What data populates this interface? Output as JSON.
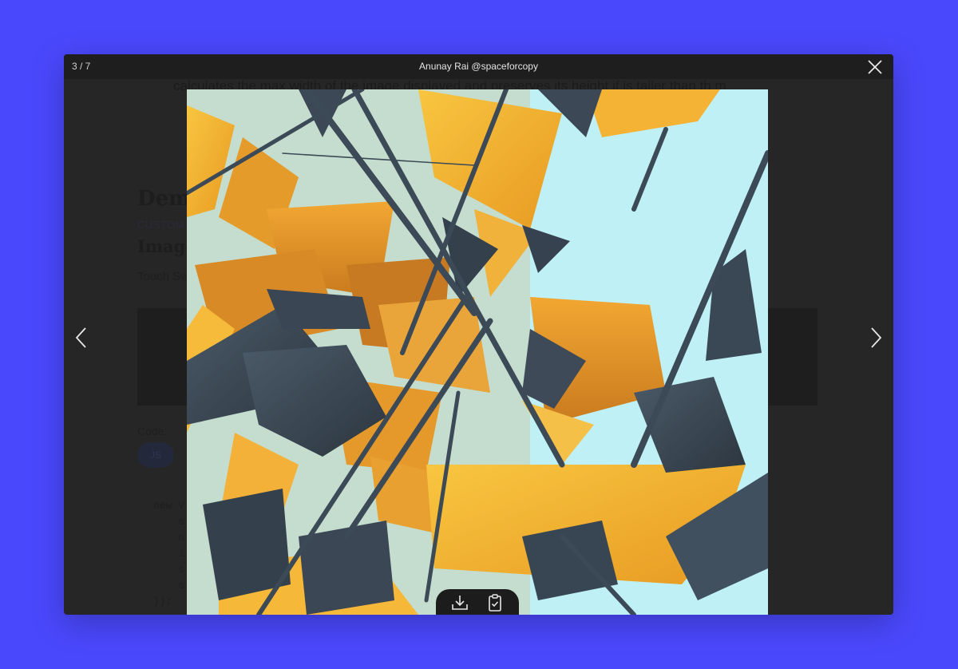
{
  "header": {
    "counter": "3 / 7",
    "caption": "Anunay Rai @spaceforcopy"
  },
  "icons": {
    "close": "close-icon",
    "prev": "chevron-left-icon",
    "next": "chevron-right-icon",
    "download": "download-icon",
    "copy": "clipboard-check-icon"
  },
  "background_page": {
    "paragraph": "calculates the max width of the image displayed and preserves its height if is taller than th m",
    "demo_heading": "Dem",
    "custom_label": "CUSTOM",
    "image_heading": "Image",
    "touch_text": "Touch Sw",
    "code_label": "Code:",
    "js_tab": "JS",
    "code": "new V\n    s\n    n\n    i\n    s\n    s\n});"
  },
  "colors": {
    "page_bg": "#4a48fc",
    "window_bg": "#262626",
    "header_bg": "#1e1e1e",
    "image_sky": "#bff0f5",
    "shard_yellow": "#f5b335",
    "shard_slate": "#3d4a57"
  }
}
